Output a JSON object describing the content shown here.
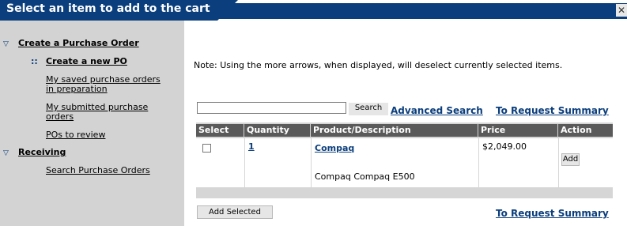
{
  "dialog": {
    "title": "Select an item to add to the cart",
    "close_glyph": "✕"
  },
  "sidebar": {
    "sections": [
      {
        "label": "Create a Purchase Order",
        "items": [
          {
            "label": "Create a new PO",
            "current": true
          },
          {
            "label": "My saved purchase orders in preparation"
          },
          {
            "label": "My submitted purchase orders"
          },
          {
            "label": "POs to review"
          }
        ]
      },
      {
        "label": "Receiving",
        "items": [
          {
            "label": "Search Purchase Orders"
          }
        ]
      }
    ]
  },
  "main": {
    "note": "Note: Using the more arrows, when displayed, will deselect currently selected items.",
    "search": {
      "value": "",
      "button_label": "Search"
    },
    "advanced_search_label": "Advanced Search",
    "request_summary_label": "To Request Summary",
    "add_selected_label": "Add Selected"
  },
  "table": {
    "columns": [
      "Select",
      "Quantity",
      "Product/Description",
      "Price",
      "Action"
    ],
    "rows": [
      {
        "quantity": "1",
        "product": "Compaq",
        "description": "Compaq Compaq E500",
        "price": "$2,049.00",
        "action": "Add"
      }
    ]
  },
  "colors": {
    "title_bar": "#0b3e7c",
    "sidebar_bg": "#d3d3d3",
    "header_bg": "#5a5a5a",
    "link": "#0b3e7c"
  }
}
